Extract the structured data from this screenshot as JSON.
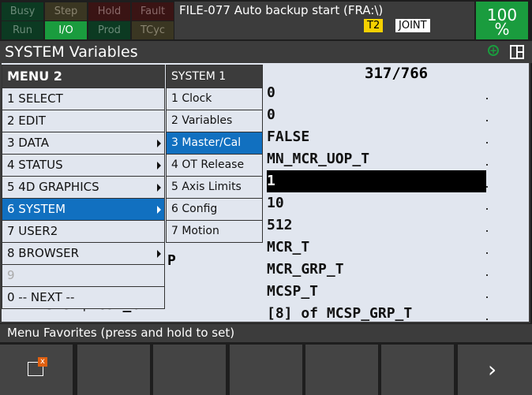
{
  "status_indicators": [
    {
      "label": "Busy",
      "bg": "#0c3a22",
      "fg": "#6a8a78"
    },
    {
      "label": "Step",
      "bg": "#3a3622",
      "fg": "#8a8470"
    },
    {
      "label": "Hold",
      "bg": "#3a1414",
      "fg": "#8a6a6a"
    },
    {
      "label": "Fault",
      "bg": "#3a1414",
      "fg": "#8a6a6a"
    },
    {
      "label": "Run",
      "bg": "#0c3a22",
      "fg": "#6a8a78"
    },
    {
      "label": "I/O",
      "bg": "#1a9c3e",
      "fg": "#ffffff"
    },
    {
      "label": "Prod",
      "bg": "#0c3a22",
      "fg": "#6a8a78"
    },
    {
      "label": "TCyc",
      "bg": "#3a3622",
      "fg": "#8a8470"
    }
  ],
  "message": "FILE-077 Auto backup start (FRA:\\)",
  "mode_badge": "T2",
  "coord_badge": "JOINT",
  "override": {
    "value": "100",
    "unit": "%"
  },
  "screen_title": "SYSTEM Variables",
  "counter": "317/766",
  "values": [
    "0",
    "0",
    "FALSE",
    "MN_MCR_UOP_T",
    "1",
    "10",
    "512",
    "MCR_T",
    "MCR_GRP_T",
    "MCSP_T",
    "[8] of MCSP_GRP_T"
  ],
  "selected_value_index": 4,
  "hidden_fragments": {
    "row_mcr_grp": "P",
    "row_mcsp_grp": "323 $MCSP_GRP"
  },
  "menu": {
    "title": "MENU  2",
    "items": [
      {
        "label": "1 SELECT",
        "arrow": false
      },
      {
        "label": "2 EDIT",
        "arrow": false
      },
      {
        "label": "3 DATA",
        "arrow": true
      },
      {
        "label": "4 STATUS",
        "arrow": true
      },
      {
        "label": "5 4D GRAPHICS",
        "arrow": true
      },
      {
        "label": "6 SYSTEM",
        "arrow": true,
        "selected": true
      },
      {
        "label": "7 USER2",
        "arrow": false
      },
      {
        "label": "8 BROWSER",
        "arrow": true
      },
      {
        "label": "9",
        "arrow": false,
        "disabled": true
      },
      {
        "label": "0 -- NEXT --",
        "arrow": false
      }
    ]
  },
  "submenu": {
    "title": "SYSTEM  1",
    "items": [
      {
        "label": "1 Clock"
      },
      {
        "label": "2 Variables"
      },
      {
        "label": "3 Master/Cal",
        "selected": true
      },
      {
        "label": "4 OT Release"
      },
      {
        "label": "5 Axis Limits"
      },
      {
        "label": "6 Config"
      },
      {
        "label": "7 Motion"
      }
    ]
  },
  "status_line": "Menu Favorites (press and hold to set)",
  "function_keys": [
    {
      "icon": "window-close-icon"
    },
    {},
    {},
    {},
    {},
    {},
    {
      "icon": "chevron-right-icon"
    }
  ]
}
